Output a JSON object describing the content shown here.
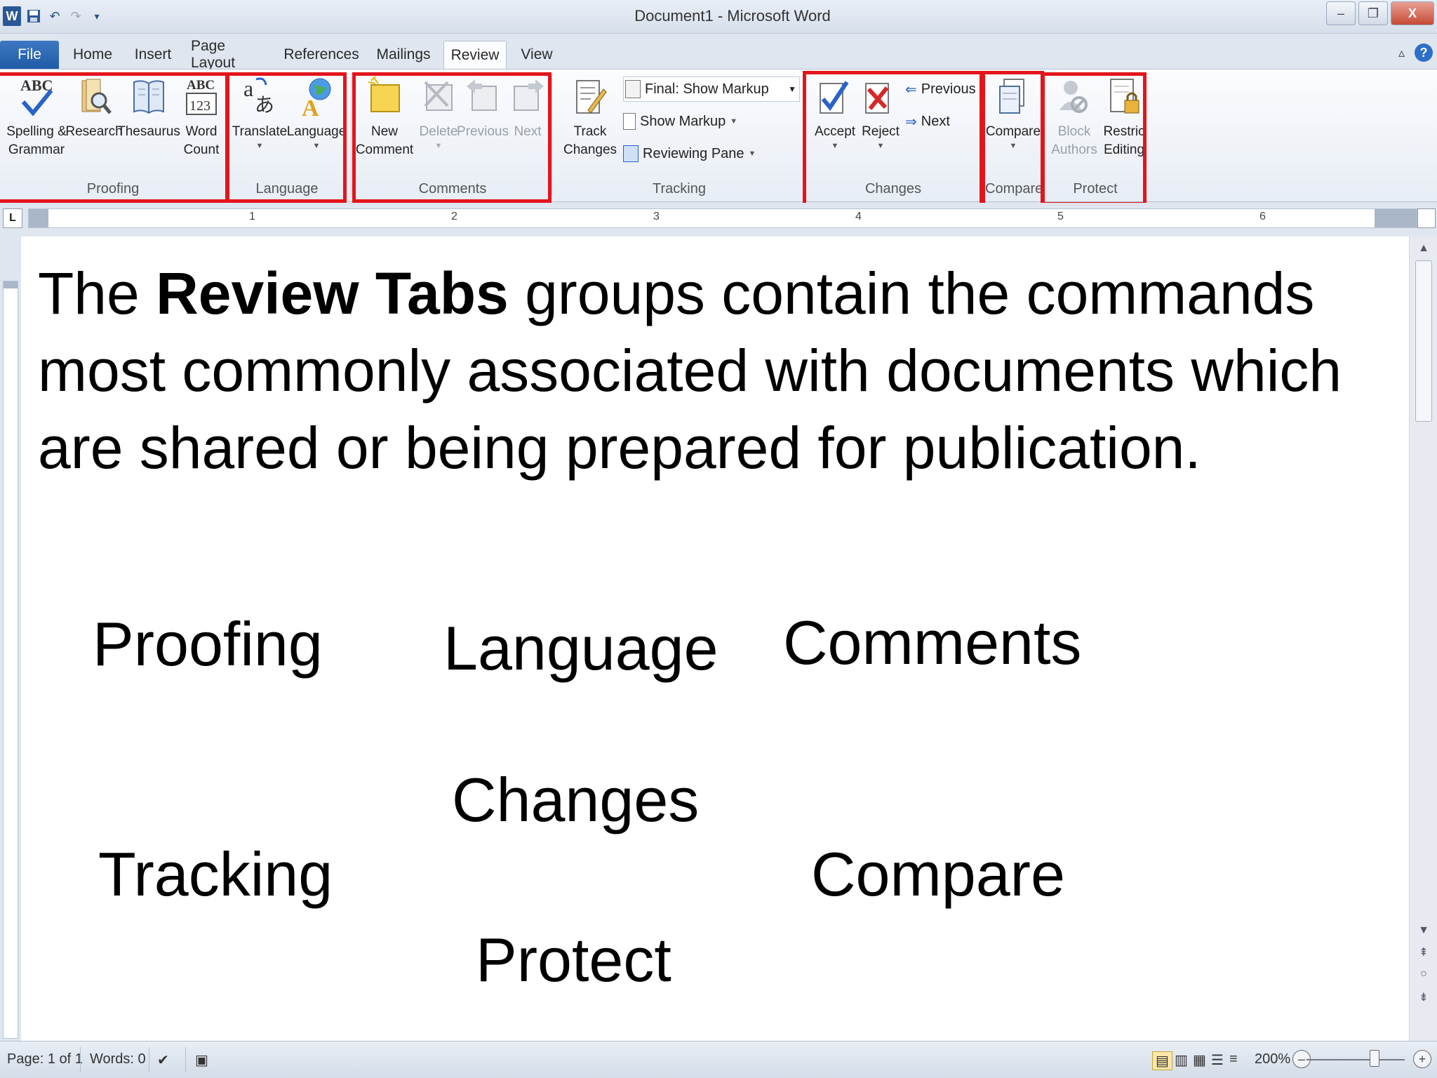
{
  "titlebar": {
    "title": "Document1  -  Microsoft Word",
    "logo": "W",
    "qat_icons": [
      "word-logo",
      "save-icon",
      "undo-icon",
      "redo-icon",
      "customize-icon"
    ]
  },
  "tabs": [
    "File",
    "Home",
    "Insert",
    "Page Layout",
    "References",
    "Mailings",
    "Review",
    "View"
  ],
  "active_tab": "Review",
  "ribbon": {
    "proofing": {
      "label": "Proofing",
      "spelling": "Spelling &\nGrammar",
      "research": "Research",
      "thesaurus": "Thesaurus",
      "word_count": "Word\nCount"
    },
    "language": {
      "label": "Language",
      "translate": "Translate",
      "language": "Language"
    },
    "comments": {
      "label": "Comments",
      "new_comment": "New\nComment",
      "delete": "Delete",
      "previous": "Previous",
      "next": "Next"
    },
    "tracking": {
      "label": "Tracking",
      "track_changes": "Track\nChanges",
      "display_mode": "Final: Show Markup",
      "show_markup": "Show Markup",
      "reviewing_pane": "Reviewing Pane"
    },
    "changes": {
      "label": "Changes",
      "accept": "Accept",
      "reject": "Reject",
      "previous": "Previous",
      "next": "Next"
    },
    "compare": {
      "label": "Compare",
      "compare": "Compare"
    },
    "protect": {
      "label": "Protect",
      "block_authors": "Block\nAuthors",
      "restrict_editing": "Restric\nEditing"
    }
  },
  "ruler": {
    "numbers": [
      "1",
      "2",
      "3",
      "4",
      "5",
      "6"
    ],
    "tab_selector": "L"
  },
  "document": {
    "para_start": "The ",
    "para_bold": "Review Tabs",
    "para_end": " groups contain the commands most commonly associated with documents which are shared or being prepared for publication.",
    "words": {
      "proofing": "Proofing",
      "language": "Language",
      "comments": "Comments",
      "changes": "Changes",
      "tracking": "Tracking",
      "compare": "Compare",
      "protect": "Protect"
    }
  },
  "statusbar": {
    "page": "Page: 1 of 1",
    "words": "Words: 0",
    "zoom": "200%"
  },
  "colors": {
    "highlight_box": "#e3151c",
    "file_tab": "#2b5fa8",
    "ribbon_bg": "#f5f8fc"
  }
}
